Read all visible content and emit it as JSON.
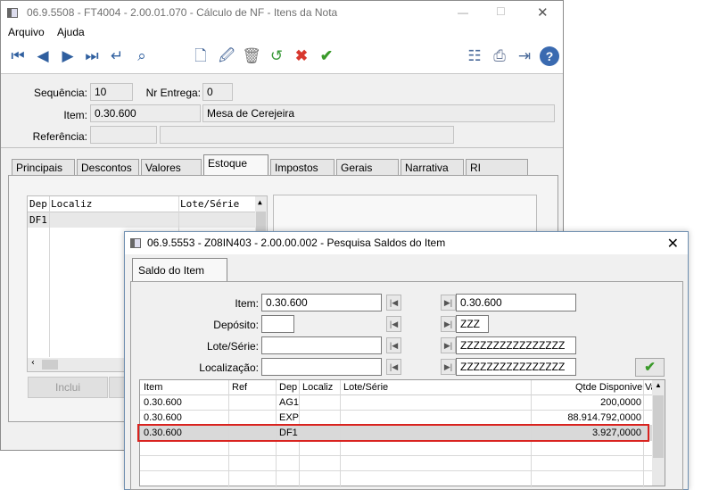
{
  "main": {
    "title": "06.9.5508 - FT4004 - 2.00.01.070 - Cálculo de NF - Itens da Nota",
    "menu": [
      "Arquivo",
      "Ajuda"
    ],
    "fields": {
      "sequencia_label": "Sequência:",
      "sequencia": "10",
      "nr_entrega_label": "Nr Entrega:",
      "nr_entrega": "0",
      "item_label": "Item:",
      "item": "0.30.600",
      "item_desc": "Mesa de Cerejeira",
      "referencia_label": "Referência:"
    },
    "tabs": [
      "Principais",
      "Descontos",
      "Valores",
      "Estoque",
      "Impostos",
      "Gerais",
      "Narrativa",
      "RI"
    ],
    "active_tab": "Estoque",
    "grid": {
      "headers": [
        "Dep",
        "Localiz",
        "Lote/Série"
      ],
      "rows": [
        [
          "DF1",
          "",
          ""
        ]
      ]
    },
    "inclui_label": "Inclui"
  },
  "dialog": {
    "title": "06.9.5553 - Z08IN403 - 2.00.00.002 - Pesquisa Saldos do Item",
    "tab": "Saldo do Item",
    "filters": [
      {
        "label": "Item:",
        "from": "0.30.600",
        "to": "0.30.600"
      },
      {
        "label": "Depósito:",
        "from": "",
        "to": "ZZZ"
      },
      {
        "label": "Lote/Série:",
        "from": "",
        "to": "ZZZZZZZZZZZZZZZZ"
      },
      {
        "label": "Localização:",
        "from": "",
        "to": "ZZZZZZZZZZZZZZZZ"
      }
    ],
    "grid_headers": [
      "Item",
      "Ref",
      "Dep",
      "Localiz",
      "Lote/Série",
      "Qtde Disponivel",
      "Va"
    ],
    "grid_rows": [
      [
        "0.30.600",
        "",
        "AG1",
        "",
        "",
        "200,0000"
      ],
      [
        "0.30.600",
        "",
        "EXP",
        "",
        "",
        "88.914.792,0000"
      ],
      [
        "0.30.600",
        "",
        "DF1",
        "",
        "",
        "3.927,0000"
      ]
    ],
    "highlight_color": "#d9231f"
  }
}
